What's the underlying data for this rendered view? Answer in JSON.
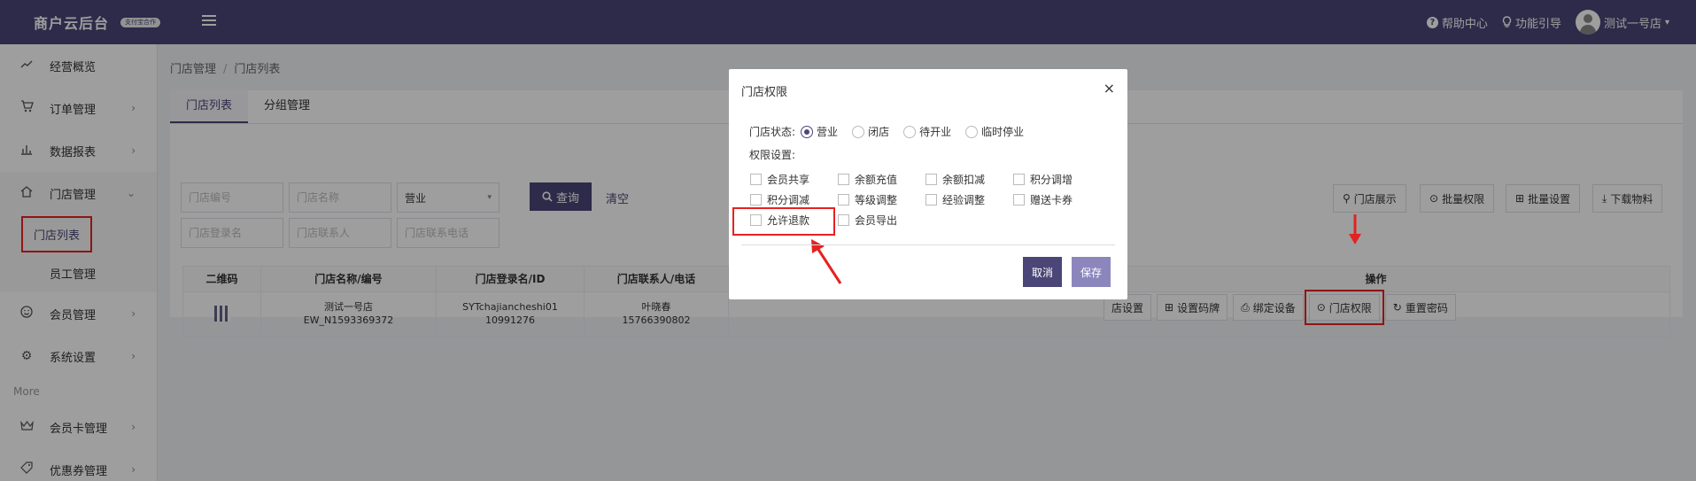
{
  "header": {
    "logo": "商户云后台",
    "logo_badge": "支付宝合作",
    "help": "帮助中心",
    "guide": "功能引导",
    "user": "测试一号店"
  },
  "sidebar": {
    "items": [
      {
        "label": "经营概览",
        "icon": "trend-icon"
      },
      {
        "label": "订单管理",
        "icon": "cart-icon"
      },
      {
        "label": "数据报表",
        "icon": "bar-chart-icon"
      },
      {
        "label": "门店管理",
        "icon": "home-icon"
      },
      {
        "label": "门店列表"
      },
      {
        "label": "员工管理"
      },
      {
        "label": "会员管理",
        "icon": "smile-icon"
      },
      {
        "label": "系统设置",
        "icon": "gear-icon"
      }
    ],
    "more": "More",
    "more_items": [
      {
        "label": "会员卡管理",
        "icon": "crown-icon"
      },
      {
        "label": "优惠券管理",
        "icon": "tag-icon"
      }
    ]
  },
  "breadcrumb": [
    "门店管理",
    "门店列表"
  ],
  "tabs": [
    "门店列表",
    "分组管理"
  ],
  "filters": {
    "store_no": "门店编号",
    "store_name": "门店名称",
    "status": "营业",
    "login_name": "门店登录名",
    "contact": "门店联系人",
    "phone": "门店联系电话",
    "query": "查询",
    "clear": "清空"
  },
  "toolbar": [
    "门店展示",
    "批量权限",
    "批量设置",
    "下载物料"
  ],
  "table": {
    "headers": [
      "二维码",
      "门店名称/编号",
      "门店登录名/ID",
      "门店联系人/电话",
      "操作"
    ],
    "row": {
      "name": "测试一号店",
      "code": "EW_N1593369372",
      "login": "SYTchajiancheshi01",
      "id": "10991276",
      "contact": "叶晓春",
      "phone": "15766390802"
    },
    "ops": [
      "店设置",
      "设置码牌",
      "绑定设备",
      "门店权限",
      "重置密码"
    ]
  },
  "modal": {
    "title": "门店权限",
    "status_label": "门店状态:",
    "status_options": [
      "营业",
      "闭店",
      "待开业",
      "临时停业"
    ],
    "perm_label": "权限设置:",
    "perms": [
      "会员共享",
      "余额充值",
      "余额扣减",
      "积分调增",
      "积分调减",
      "等级调整",
      "经验调整",
      "赠送卡券",
      "允许退款",
      "会员导出"
    ],
    "cancel": "取消",
    "save": "保存"
  },
  "colors": {
    "primary": "#4a4677",
    "highlight": "#e52222"
  }
}
